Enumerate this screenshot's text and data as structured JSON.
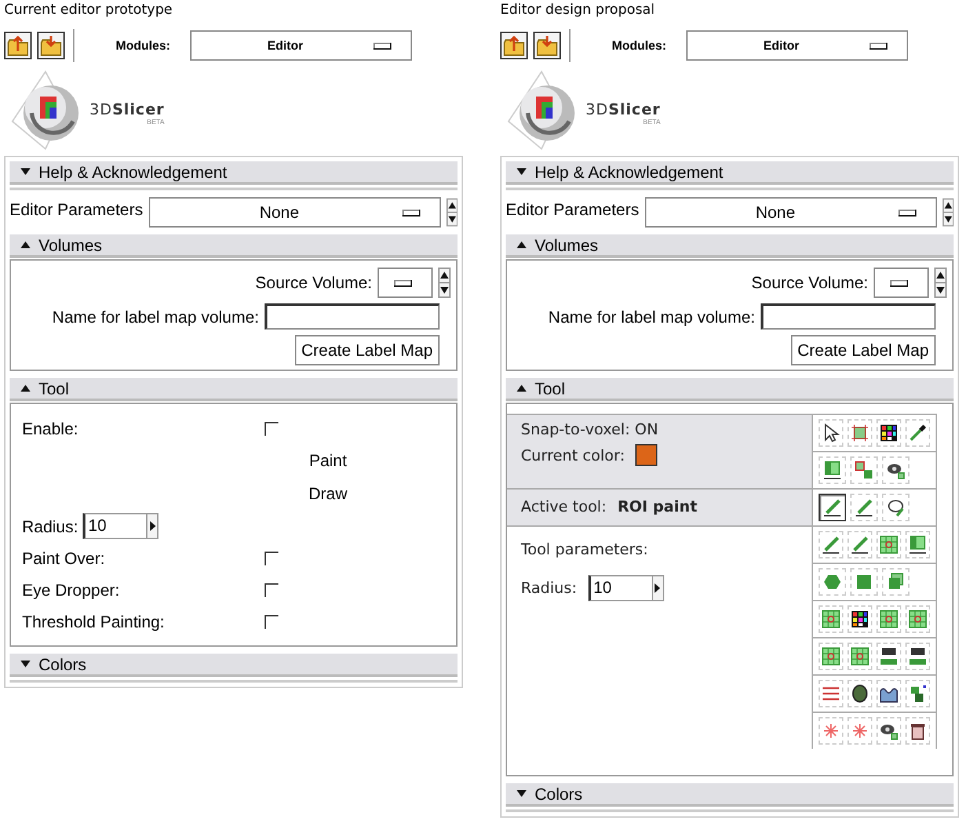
{
  "panels": [
    {
      "caption": "Current editor prototype",
      "toolbar": {
        "modules_label": "Modules:",
        "module": "Editor"
      },
      "logo": {
        "text": "3D**Slicer**",
        "badge": "BETA"
      },
      "help": {
        "title": "Help & Acknowledgement",
        "expanded": false
      },
      "parameters": {
        "label": "Editor Parameters",
        "value": "None"
      },
      "volumes": {
        "title": "Volumes",
        "expanded": true,
        "source_label": "Source Volume:",
        "name_label": "Name for label map volume:",
        "button": "Create Label Map"
      },
      "tool": {
        "title": "Tool",
        "expanded": true,
        "kind": "form",
        "items": [
          {
            "kind": "checkbox",
            "label": "Enable:",
            "checked": false
          },
          {
            "kind": "option",
            "label": "Paint"
          },
          {
            "kind": "option",
            "label": "Draw"
          },
          {
            "kind": "spin",
            "label": "Radius:",
            "value": "10"
          },
          {
            "kind": "checkbox",
            "label": "Paint Over:",
            "checked": false
          },
          {
            "kind": "checkbox",
            "label": "Eye Dropper:",
            "checked": false
          },
          {
            "kind": "checkbox",
            "label": "Threshold Painting:",
            "checked": false
          }
        ]
      },
      "colors": {
        "title": "Colors",
        "expanded": false
      }
    },
    {
      "caption": "Editor design proposal",
      "toolbar": {
        "modules_label": "Modules:",
        "module": "Editor"
      },
      "logo": {
        "text": "3D**Slicer**",
        "badge": "BETA"
      },
      "help": {
        "title": "Help & Acknowledgement",
        "expanded": false
      },
      "parameters": {
        "label": "Editor Parameters",
        "value": "None"
      },
      "volumes": {
        "title": "Volumes",
        "expanded": true,
        "source_label": "Source Volume:",
        "name_label": "Name for label map volume:",
        "button": "Create Label Map"
      },
      "tool": {
        "title": "Tool",
        "expanded": true,
        "kind": "palette",
        "groups": [
          {
            "kind": "state",
            "snap": "Snap-to-voxel: ON",
            "color_label": "Current color:",
            "color": "#dc6518",
            "rows": [
              [
                {
                  "kind": "pointer",
                  "selected": false
                },
                {
                  "kind": "crosshair",
                  "selected": false
                },
                {
                  "kind": "swatches",
                  "selected": false
                },
                {
                  "kind": "eyedropper",
                  "selected": false
                }
              ],
              [
                {
                  "kind": "gradient",
                  "selected": false
                },
                {
                  "kind": "squares",
                  "selected": false
                },
                {
                  "kind": "eye",
                  "selected": false
                }
              ]
            ]
          },
          {
            "kind": "active",
            "label": "Active tool:",
            "value": "ROI paint",
            "rows": [
              [
                {
                  "kind": "pencil",
                  "selected": true
                },
                {
                  "kind": "pencil",
                  "selected": false
                },
                {
                  "kind": "lasso",
                  "selected": false
                }
              ]
            ]
          },
          {
            "kind": "params",
            "label": "Tool parameters:",
            "radius_label": "Radius:",
            "radius": "10",
            "rows": [
              [
                {
                  "kind": "pencil",
                  "selected": false
                },
                {
                  "kind": "pencil",
                  "selected": false
                },
                {
                  "kind": "grid",
                  "selected": false
                },
                {
                  "kind": "gradient",
                  "selected": false
                }
              ],
              [
                {
                  "kind": "hexagon",
                  "selected": false
                },
                {
                  "kind": "block",
                  "selected": false
                },
                {
                  "kind": "cube",
                  "selected": false
                }
              ],
              [
                {
                  "kind": "grid",
                  "selected": false
                },
                {
                  "kind": "swatches",
                  "selected": false
                },
                {
                  "kind": "grid",
                  "selected": false
                },
                {
                  "kind": "grid",
                  "selected": false
                }
              ],
              [
                {
                  "kind": "grid",
                  "selected": false
                },
                {
                  "kind": "grid",
                  "selected": false
                },
                {
                  "kind": "filter",
                  "selected": false
                },
                {
                  "kind": "filter",
                  "selected": false
                }
              ],
              [
                {
                  "kind": "lines",
                  "selected": false
                },
                {
                  "kind": "blob",
                  "selected": false
                },
                {
                  "kind": "wave",
                  "selected": false
                },
                {
                  "kind": "stack",
                  "selected": false
                }
              ],
              [
                {
                  "kind": "spark",
                  "selected": false
                },
                {
                  "kind": "spark",
                  "selected": false
                },
                {
                  "kind": "eye",
                  "selected": false
                },
                {
                  "kind": "trash",
                  "selected": false
                }
              ]
            ]
          }
        ]
      },
      "colors": {
        "title": "Colors",
        "expanded": false
      }
    }
  ]
}
